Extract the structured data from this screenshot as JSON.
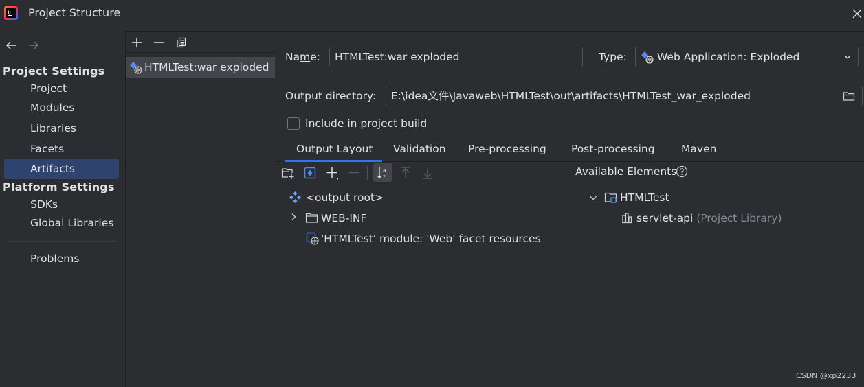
{
  "window": {
    "title": "Project Structure"
  },
  "nav": {
    "project_settings_header": "Project Settings",
    "platform_settings_header": "Platform Settings",
    "items": [
      {
        "label": "Project"
      },
      {
        "label": "Modules"
      },
      {
        "label": "Libraries"
      },
      {
        "label": "Facets"
      },
      {
        "label": "Artifacts",
        "selected": true
      },
      {
        "label": "SDKs"
      },
      {
        "label": "Global Libraries"
      },
      {
        "label": "Problems"
      }
    ]
  },
  "artifacts": {
    "list": [
      {
        "label": "HTMLTest:war exploded",
        "selected": true
      }
    ]
  },
  "form": {
    "name_label_pre": "Na",
    "name_label_mnemonic": "m",
    "name_label_post": "e:",
    "name_value": "HTMLTest:war exploded",
    "type_label": "Type:",
    "type_value": "Web Application: Exploded",
    "output_label": "Output directory:",
    "output_value": "E:\\idea文件\\Javaweb\\HTMLTest\\out\\artifacts\\HTMLTest_war_exploded",
    "include_label_pre": "Include in project ",
    "include_label_mnemonic": "b",
    "include_label_post": "uild",
    "include_checked": false
  },
  "tabs": [
    {
      "label": "Output Layout",
      "active": true
    },
    {
      "label": "Validation"
    },
    {
      "label": "Pre-processing"
    },
    {
      "label": "Post-processing"
    },
    {
      "label": "Maven"
    }
  ],
  "layout_tree": {
    "root": "<output root>",
    "webinf": "WEB-INF",
    "module_resource": "'HTMLTest' module: 'Web' facet resources"
  },
  "available": {
    "title": "Available Elements",
    "module": "HTMLTest",
    "library_name": "servlet-api",
    "library_note": "(Project Library)"
  },
  "watermark": "CSDN @xp2233",
  "colors": {
    "background": "#2b2d30",
    "selection": "#2e436e",
    "accent": "#3574f0",
    "text": "#dfe1e5",
    "muted": "#868a91"
  }
}
